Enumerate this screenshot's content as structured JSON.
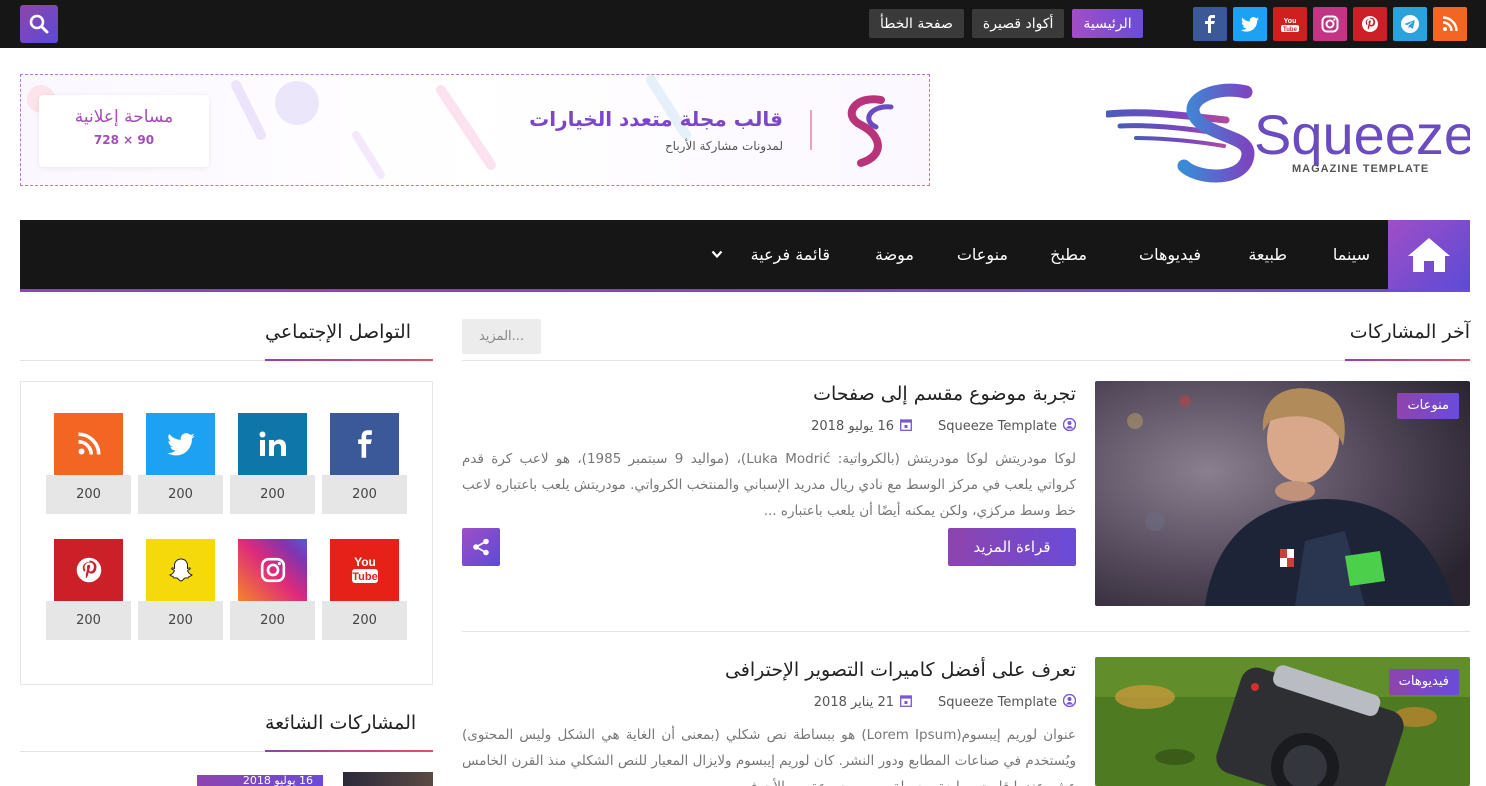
{
  "topbar": {
    "links": [
      {
        "label": "الرئيسية",
        "active": true
      },
      {
        "label": "أكواد قصيرة",
        "active": false
      },
      {
        "label": "صفحة الخطأ",
        "active": false
      }
    ],
    "social_icons": [
      {
        "icon": "rss-icon",
        "color": "#f26522"
      },
      {
        "icon": "telegram-icon",
        "color": "#2aa3dc"
      },
      {
        "icon": "pinterest-icon",
        "color": "#cb2027"
      },
      {
        "icon": "instagram-icon",
        "color": "#c13584"
      },
      {
        "icon": "youtube-icon",
        "color": "#cd201f"
      },
      {
        "icon": "twitter-icon",
        "color": "#1da1f2"
      },
      {
        "icon": "facebook-icon",
        "color": "#3b5998"
      }
    ]
  },
  "logo": {
    "name": "Squeeze",
    "tagline": "MAGAZINE TEMPLATE"
  },
  "banner": {
    "title": "قالب مجلة متعدد الخيارات",
    "subtitle": "لمدونات مشاركة الأرباح",
    "ad_label": "مساحة إعلانية",
    "ad_size": "728 × 90"
  },
  "nav": {
    "items": [
      "سينما",
      "طبيعة",
      "فيديوهات",
      "مطبخ",
      "منوعات",
      "موضة",
      "قائمة فرعية"
    ]
  },
  "main": {
    "section_title": "آخر المشاركات",
    "more_label": "المزيد...",
    "posts": [
      {
        "category": "منوعات",
        "title": "تجربة موضوع مقسم إلى صفحات",
        "author": "Squeeze Template",
        "date": "16 يوليو 2018",
        "excerpt": "لوكا مودريتش لوكا مودريتش (بالكرواتية: Luka Modrić)، (مواليد 9 سبتمبر 1985)، هو لاعب كرة قدم كرواتي يلعب في مركز الوسط مع نادي ريال مدريد الإسباني والمنتخب الكرواتي. مودريتش يلعب باعتباره لاعب خط وسط مركزي، ولكن يمكنه أيضًا أن يلعب باعتباره ...",
        "read_more": "قراءة المزيد"
      },
      {
        "category": "فيديوهات",
        "title": "تعرف على أفضل كاميرات التصوير الإحترافى",
        "author": "Squeeze Template",
        "date": "21 يناير 2018",
        "excerpt": "عنوان لوريم إيبسوم(Lorem Ipsum) هو ببساطة نص شكلي (بمعنى أن الغاية هي الشكل وليس المحتوى) ويُستخدم في صناعات المطابع ودور النشر. كان لوريم إيبسوم ولايزال المعيار للنص الشكلي منذ القرن الخامس عشر عندما قامت مطبعة مجهولة برص مجموعة من الأحرف"
      }
    ]
  },
  "sidebar": {
    "social_title": "التواصل الإجتماعي",
    "social_counts": [
      {
        "icon": "facebook-icon",
        "color": "#3b5998",
        "count": "200"
      },
      {
        "icon": "linkedin-icon",
        "color": "#0e76a8",
        "count": "200"
      },
      {
        "icon": "twitter-icon",
        "color": "#1da1f2",
        "count": "200"
      },
      {
        "icon": "rss-icon",
        "color": "#f26522",
        "count": "200"
      },
      {
        "icon": "youtube-icon",
        "color": "#e62117",
        "count": "200"
      },
      {
        "icon": "instagram-icon",
        "color": "#c13584",
        "count": "200"
      },
      {
        "icon": "snapchat-icon",
        "color": "#f5d90a",
        "count": "200"
      },
      {
        "icon": "pinterest-icon",
        "color": "#cb2027",
        "count": "200"
      }
    ],
    "popular_title": "المشاركات الشائعة",
    "popular_first_date": "16 يوليو 2018"
  },
  "colors": {
    "accent": "#8e44ad",
    "accent2": "#6a4cd9",
    "dark": "#161616"
  }
}
